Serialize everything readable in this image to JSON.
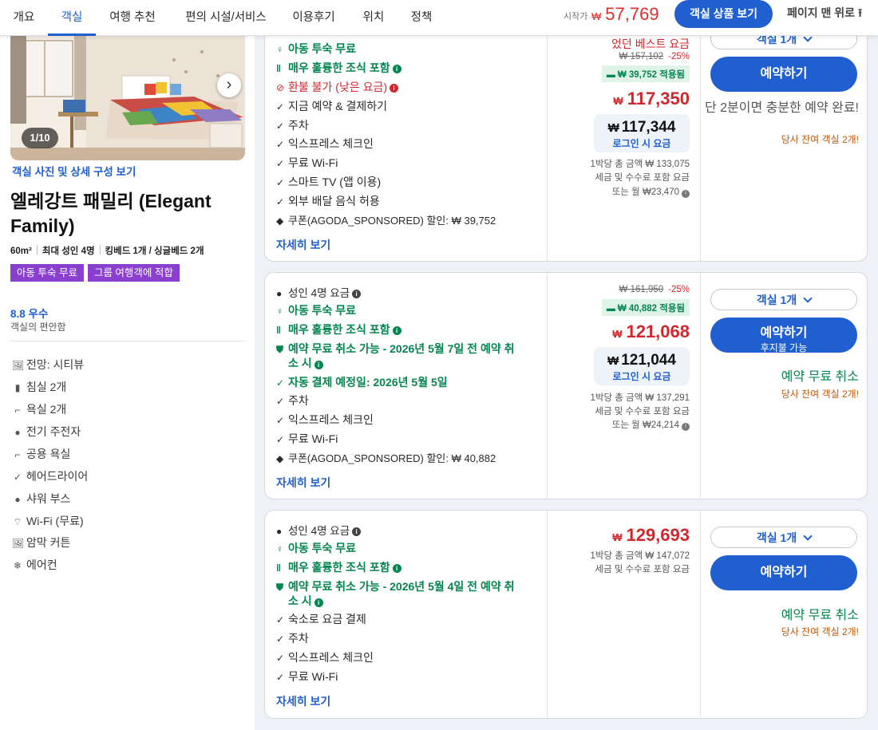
{
  "nav": {
    "tabs": [
      "개요",
      "객실",
      "여행 추천",
      "편의 시설/서비스",
      "이용후기",
      "위치",
      "정책"
    ],
    "from_label": "시작가",
    "from_currency": "₩",
    "from_price": "57,769",
    "view_rooms": "객실 상품 보기",
    "back_top": "페이지 맨 위로"
  },
  "room": {
    "photo_count": "1/10",
    "photo_link": "객실 사진 및 상세 구성 보기",
    "title": "엘레강트 패밀리 (Elegant Family)",
    "area": "60m²",
    "occupancy": "최대 성인 4명",
    "beds": "킹베드 1개 / 싱글베드 2개",
    "badges": [
      "아동 투숙 무료",
      "그룹 여행객에 적합"
    ],
    "score": "8.8 우수",
    "score_sub": "객실의 편안함",
    "amenities": [
      {
        "icon": "view-icon",
        "label": "전망: 시티뷰"
      },
      {
        "icon": "bedroom-icon",
        "label": "침실 2개"
      },
      {
        "icon": "bathroom-icon",
        "label": "욕실 2개"
      },
      {
        "icon": "kettle-icon",
        "label": "전기 주전자"
      },
      {
        "icon": "shared-bathroom-icon",
        "label": "공용 욕실"
      },
      {
        "icon": "check-icon",
        "label": "헤어드라이어"
      },
      {
        "icon": "shower-icon",
        "label": "샤워 부스"
      },
      {
        "icon": "wifi-icon",
        "label": "Wi-Fi (무료)"
      },
      {
        "icon": "curtain-icon",
        "label": "암막 커튼"
      },
      {
        "icon": "aircon-icon",
        "label": "에어컨"
      }
    ]
  },
  "offers": [
    {
      "features": [
        {
          "icon": "child-icon",
          "text": "아동 투숙 무료",
          "style": "green"
        },
        {
          "icon": "breakfast-icon",
          "text": "매우 훌륭한 조식 포함",
          "style": "green",
          "info": true
        },
        {
          "icon": "no-refund-icon",
          "text": "환불 불가 (낮은 요금)",
          "style": "red",
          "info": true
        },
        {
          "icon": "check-icon",
          "text": "지금 예약 & 결제하기",
          "style": ""
        },
        {
          "icon": "check-icon",
          "text": "주차",
          "style": ""
        },
        {
          "icon": "check-icon",
          "text": "익스프레스 체크인",
          "style": ""
        },
        {
          "icon": "check-icon",
          "text": "무료 Wi-Fi",
          "style": ""
        },
        {
          "icon": "check-icon",
          "text": "스마트 TV (앱 이용)",
          "style": ""
        },
        {
          "icon": "check-icon",
          "text": "외부 배달 음식 허용",
          "style": ""
        },
        {
          "icon": "tag-icon",
          "text": "쿠폰(AGODA_SPONSORED) 할인: ₩ 39,752",
          "style": ""
        }
      ],
      "more": "자세히 보기",
      "best_label": "었던 베스트 요금",
      "original": "₩ 157,102",
      "discount": "-25%",
      "applied": "₩ 39,752 적용됨",
      "currency": "₩",
      "price": "117,350",
      "login_currency": "₩",
      "login_price": "117,344",
      "login_label": "로그인 시 요금",
      "total": "1박당 총 금액 ₩ 133,075",
      "tax": "세금 및 수수료 포함 요금",
      "monthly": "또는 월 ₩23,470",
      "select": "객실 1개",
      "book": "예약하기",
      "hurry": "단 2분이면 충분한 예약 완료!",
      "left": "당사 잔여 객실 2개!"
    },
    {
      "occupancy": "성인 4명 요금",
      "features": [
        {
          "icon": "child-icon",
          "text": "아동 투숙 무료",
          "style": "green"
        },
        {
          "icon": "breakfast-icon",
          "text": "매우 훌륭한 조식 포함",
          "style": "green",
          "info": true
        },
        {
          "icon": "shield-icon",
          "text": "예약 무료 취소 가능 - 2026년 5월 7일 전 예약 취",
          "style": "green"
        },
        {
          "icon": "",
          "text": "소 시",
          "style": "green",
          "info": true,
          "cont": true
        },
        {
          "icon": "check-icon",
          "text": "자동 결제 예정일: 2026년 5월 5일",
          "style": "green"
        },
        {
          "icon": "check-icon",
          "text": "주차",
          "style": ""
        },
        {
          "icon": "check-icon",
          "text": "익스프레스 체크인",
          "style": ""
        },
        {
          "icon": "check-icon",
          "text": "무료 Wi-Fi",
          "style": ""
        },
        {
          "icon": "tag-icon",
          "text": "쿠폰(AGODA_SPONSORED) 할인: ₩ 40,882",
          "style": ""
        }
      ],
      "more": "자세히 보기",
      "original": "₩ 161,950",
      "discount": "-25%",
      "applied": "₩ 40,882 적용됨",
      "currency": "₩",
      "price": "121,068",
      "login_currency": "₩",
      "login_price": "121,044",
      "login_label": "로그인 시 요금",
      "total": "1박당 총 금액 ₩ 137,291",
      "tax": "세금 및 수수료 포함 요금",
      "monthly": "또는 월 ₩24,214",
      "select": "객실 1개",
      "book": "예약하기",
      "book_sub": "후지불 가능",
      "free_cancel": "예약 무료 취소",
      "left": "당사 잔여 객실 2개!"
    },
    {
      "occupancy": "성인 4명 요금",
      "features": [
        {
          "icon": "child-icon",
          "text": "아동 투숙 무료",
          "style": "green"
        },
        {
          "icon": "breakfast-icon",
          "text": "매우 훌륭한 조식 포함",
          "style": "green",
          "info": true
        },
        {
          "icon": "shield-icon",
          "text": "예약 무료 취소 가능 - 2026년 5월 4일 전 예약 취",
          "style": "green"
        },
        {
          "icon": "",
          "text": "소 시",
          "style": "green",
          "info": true,
          "cont": true
        },
        {
          "icon": "check-icon",
          "text": "숙소로 요금 결제",
          "style": ""
        },
        {
          "icon": "check-icon",
          "text": "주차",
          "style": ""
        },
        {
          "icon": "check-icon",
          "text": "익스프레스 체크인",
          "style": ""
        },
        {
          "icon": "check-icon",
          "text": "무료 Wi-Fi",
          "style": ""
        }
      ],
      "more": "자세히 보기",
      "currency": "₩",
      "price": "129,693",
      "total": "1박당 총 금액 ₩ 147,072",
      "tax": "세금 및 수수료 포함 요금",
      "select": "객실 1개",
      "book": "예약하기",
      "free_cancel": "예약 무료 취소",
      "left": "당사 잔여 객실 2개!"
    }
  ]
}
